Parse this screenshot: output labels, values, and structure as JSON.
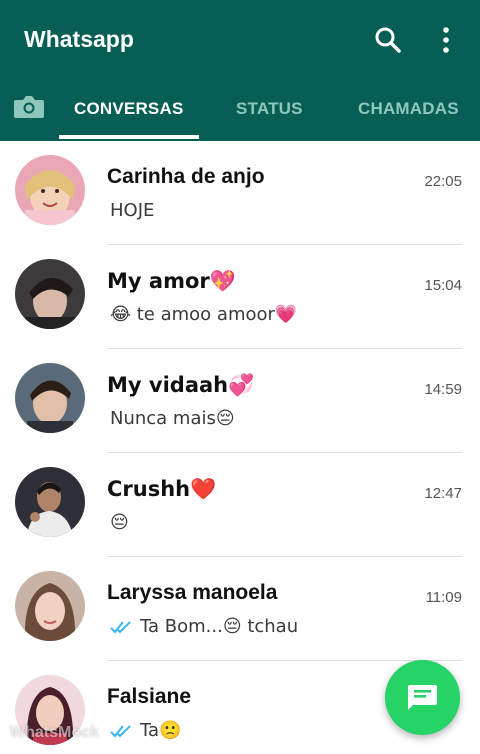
{
  "header": {
    "title": "Whatsapp",
    "search_icon": "search-icon",
    "menu_icon": "more-vert-icon",
    "background": "#075e54"
  },
  "tabs": [
    {
      "label": "CONVERSAS",
      "active": true
    },
    {
      "label": "STATUS",
      "active": false
    },
    {
      "label": "CHAMADAS",
      "active": false
    }
  ],
  "camera_icon": "camera-icon",
  "chats": [
    {
      "name": "Carinha de anjo",
      "time": "22:05",
      "preview": "HOJE",
      "ticks": false
    },
    {
      "name": "My amor💖",
      "time": "15:04",
      "preview": "😂 te amoo amoor💗",
      "ticks": false
    },
    {
      "name": "My vidaah💞",
      "time": "14:59",
      "preview": "Nunca mais😔",
      "ticks": false
    },
    {
      "name": "Crushh❤️",
      "time": "12:47",
      "preview": "😔",
      "ticks": false
    },
    {
      "name": "Laryssa manoela",
      "time": "11:09",
      "preview": "Ta Bom...😔 tchau",
      "ticks": true
    },
    {
      "name": "Falsiane",
      "time": "",
      "preview": "Ta🙁",
      "ticks": true
    }
  ],
  "fab_icon": "new-chat-icon",
  "watermark": "WhatsMock",
  "colors": {
    "primary": "#075e54",
    "fab": "#25d366",
    "read_ticks": "#34b7f1"
  }
}
